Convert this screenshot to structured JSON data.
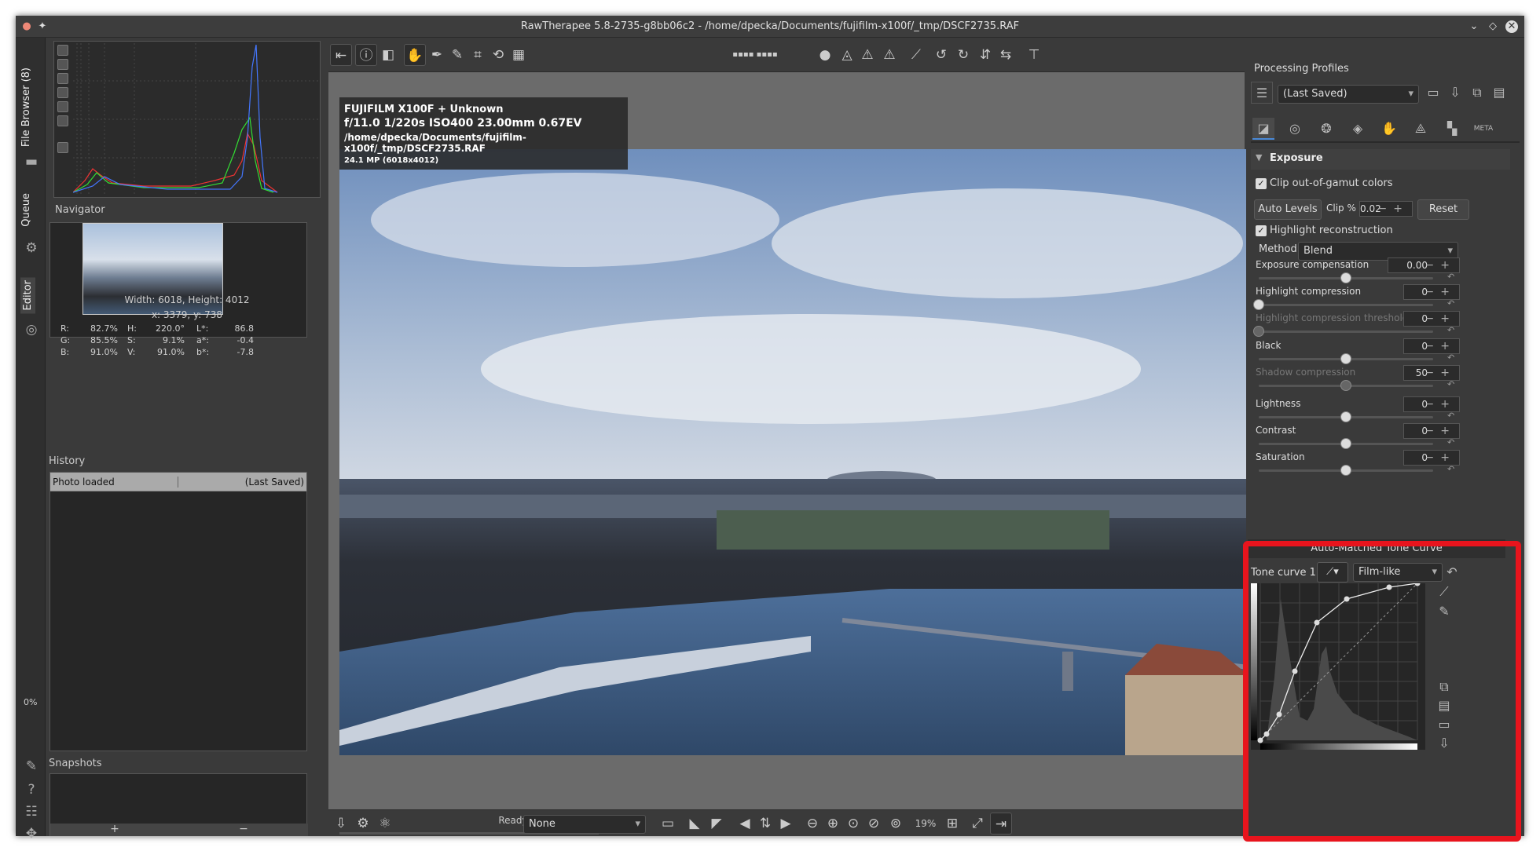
{
  "window": {
    "title": "RawTherapee 5.8-2735-g8bb06c2 - /home/dpecka/Documents/fujifilm-x100f/_tmp/DSCF2735.RAF"
  },
  "vtabs": {
    "file_browser": "File Browser (8)",
    "queue": "Queue",
    "editor": "Editor",
    "progress": "0%"
  },
  "left": {
    "navigator_title": "Navigator",
    "image_size": "Width: 6018, Height: 4012",
    "coords": "x: 3379, y: 738",
    "readout": [
      {
        "k1": "R:",
        "v1": "82.7%",
        "k2": "H:",
        "v2": "220.0°",
        "k3": "L*:",
        "v3": "86.8"
      },
      {
        "k1": "G:",
        "v1": "85.5%",
        "k2": "S:",
        "v2": "9.1%",
        "k3": "a*:",
        "v3": "-0.4"
      },
      {
        "k1": "B:",
        "v1": "91.0%",
        "k2": "V:",
        "v2": "91.0%",
        "k3": "b*:",
        "v3": "-7.8"
      }
    ],
    "history_title": "History",
    "history_row": {
      "action": "Photo loaded",
      "value": "(Last Saved)"
    },
    "snapshots_title": "Snapshots",
    "snap_add": "+",
    "snap_remove": "−"
  },
  "overlay": {
    "camera": "FUJIFILM X100F + Unknown",
    "exif": "f/11.0  1/220s  ISO400  23.00mm  0.67EV",
    "path": "/home/dpecka/Documents/fujifilm-x100f/_tmp/DSCF2735.RAF",
    "mp": "24.1 MP (6018x4012)"
  },
  "bottom": {
    "status": "Ready",
    "profile_select": "None",
    "zoom": "19%"
  },
  "right": {
    "processing_profiles": "Processing Profiles",
    "profile_value": "(Last Saved)",
    "exposure_title": "Exposure",
    "clip_gamut": "Clip out-of-gamut colors",
    "auto_levels": "Auto Levels",
    "clip_label": "Clip %",
    "clip_value": "0.02",
    "reset": "Reset",
    "highlight_recon": "Highlight reconstruction",
    "method_label": "Method:",
    "method_value": "Blend",
    "sliders": [
      {
        "label": "Exposure compensation",
        "value": "0.00",
        "level": 0.5
      },
      {
        "label": "Highlight compression",
        "value": "0",
        "level": 0.0
      },
      {
        "label": "Highlight compression threshold",
        "value": "0",
        "level": 0.0,
        "disabled": true
      },
      {
        "label": "Black",
        "value": "0",
        "level": 0.5
      },
      {
        "label": "Shadow compression",
        "value": "50",
        "level": 0.5,
        "disabled": true
      },
      {
        "label": "Lightness",
        "value": "0",
        "level": 0.5
      },
      {
        "label": "Contrast",
        "value": "0",
        "level": 0.5
      },
      {
        "label": "Saturation",
        "value": "0",
        "level": 0.5
      }
    ],
    "curve_title": "Auto-Matched Tone Curve",
    "tone_curve_label": "Tone curve 1:",
    "tone_curve_mode": "Film-like"
  },
  "colors": {
    "highlight_box": "#e8141d",
    "panel": "#3a3a3a"
  }
}
